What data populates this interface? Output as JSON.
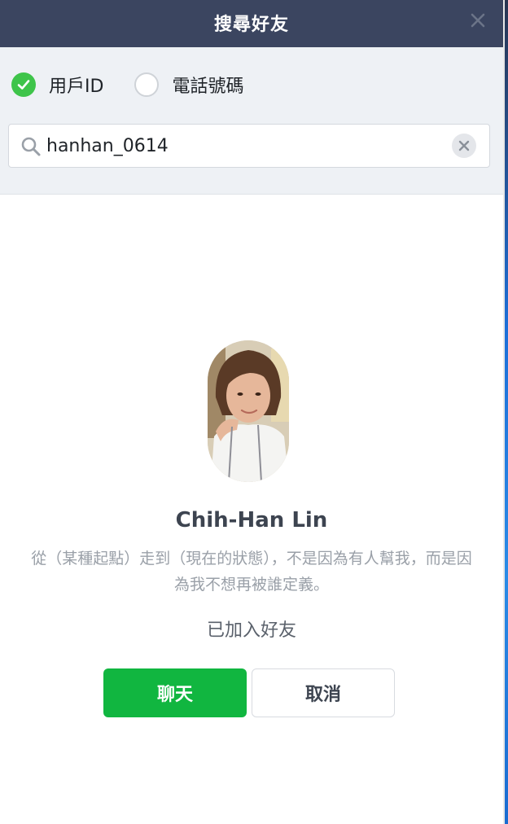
{
  "dialog": {
    "title": "搜尋好友",
    "close_icon": "close-icon"
  },
  "search_type": {
    "options": [
      {
        "label": "用戶ID",
        "selected": true
      },
      {
        "label": "電話號碼",
        "selected": false
      }
    ]
  },
  "search": {
    "value": "hanhan_0614",
    "icon": "search-icon",
    "clear_icon": "clear-icon"
  },
  "profile": {
    "name": "Chih-Han Lin",
    "status_message": "從（某種起點）走到（現在的狀態），不是因為有人幫我，而是因為我不想再被誰定義。",
    "friend_status": "已加入好友"
  },
  "actions": {
    "chat_label": "聊天",
    "cancel_label": "取消"
  },
  "colors": {
    "titlebar": "#3b4560",
    "accent_green": "#11b640",
    "radio_checked": "#3ec44a"
  }
}
